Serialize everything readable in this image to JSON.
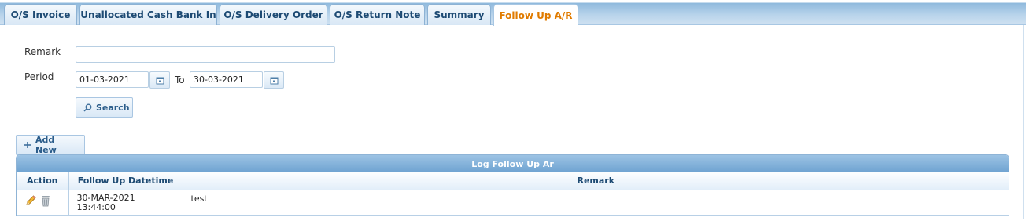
{
  "tabs": [
    {
      "label": "O/S Invoice"
    },
    {
      "label": "Unallocated Cash Bank In"
    },
    {
      "label": "O/S Delivery Order"
    },
    {
      "label": "O/S Return Note"
    },
    {
      "label": "Summary"
    },
    {
      "label": "Follow Up A/R",
      "active": true
    }
  ],
  "form": {
    "remark_label": "Remark",
    "remark_value": "",
    "period_label": "Period",
    "period_from": "01-03-2021",
    "to_label": "To",
    "period_to": "30-03-2021",
    "search_label": "Search"
  },
  "toolbar": {
    "add_new_label": "Add New"
  },
  "grid": {
    "title": "Log Follow Up Ar",
    "columns": [
      "Action",
      "Follow Up Datetime",
      "Remark"
    ],
    "rows": [
      {
        "date": "30-MAR-2021",
        "time": "13:44:00",
        "remark": "test"
      }
    ]
  },
  "icons": {
    "calendar": "calendar-icon",
    "search": "search-icon",
    "add": "plus-icon",
    "edit": "pencil-icon",
    "delete": "trash-icon"
  },
  "colors": {
    "active_tab": "#e07b00",
    "tab_text": "#1d4a73",
    "header": "#6fa3d1"
  }
}
